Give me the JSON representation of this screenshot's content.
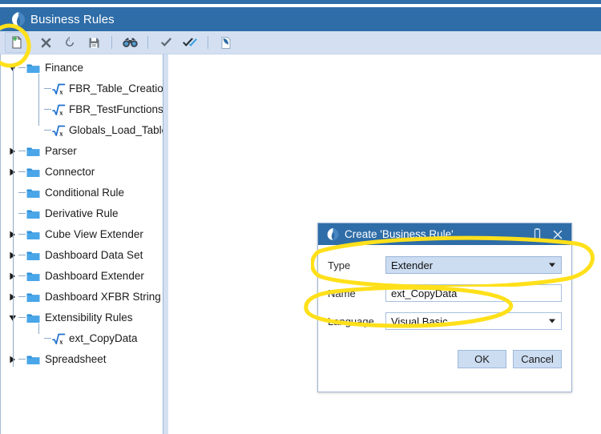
{
  "window": {
    "title": "Business Rules",
    "logo_icon": "onestream-logo-icon"
  },
  "toolbar": {
    "buttons": [
      {
        "name": "new-rule-button",
        "icon": "new-document-icon",
        "label": "New"
      },
      {
        "name": "delete-button",
        "icon": "delete-x-icon",
        "label": "Delete"
      },
      {
        "name": "refresh-button",
        "icon": "refresh-icon",
        "label": "Refresh"
      },
      {
        "name": "save-button",
        "icon": "save-disk-icon",
        "label": "Save"
      },
      {
        "name": "find-button",
        "icon": "binoculars-icon",
        "label": "Find"
      },
      {
        "name": "validate-button",
        "icon": "check-icon",
        "label": "Validate"
      },
      {
        "name": "validate-all-button",
        "icon": "double-check-icon",
        "label": "Validate and Compile"
      },
      {
        "name": "page-button",
        "icon": "page-curl-icon",
        "label": "Page"
      }
    ]
  },
  "tree": {
    "items": [
      {
        "label": "Finance",
        "level": 0,
        "icon": "folder-icon",
        "state": "expanded"
      },
      {
        "label": "FBR_Table_Creation",
        "level": 1,
        "icon": "formula-icon",
        "state": "leaf"
      },
      {
        "label": "FBR_TestFunctions",
        "level": 1,
        "icon": "formula-icon",
        "state": "leaf"
      },
      {
        "label": "Globals_Load_Table",
        "level": 1,
        "icon": "formula-icon",
        "state": "leaf"
      },
      {
        "label": "Parser",
        "level": 0,
        "icon": "folder-icon",
        "state": "collapsed"
      },
      {
        "label": "Connector",
        "level": 0,
        "icon": "folder-icon",
        "state": "collapsed"
      },
      {
        "label": "Conditional Rule",
        "level": 0,
        "icon": "folder-icon",
        "state": "empty"
      },
      {
        "label": "Derivative Rule",
        "level": 0,
        "icon": "folder-icon",
        "state": "empty"
      },
      {
        "label": "Cube View Extender",
        "level": 0,
        "icon": "folder-icon",
        "state": "collapsed"
      },
      {
        "label": "Dashboard Data Set",
        "level": 0,
        "icon": "folder-icon",
        "state": "collapsed"
      },
      {
        "label": "Dashboard Extender",
        "level": 0,
        "icon": "folder-icon",
        "state": "collapsed"
      },
      {
        "label": "Dashboard XFBR String",
        "level": 0,
        "icon": "folder-icon",
        "state": "collapsed"
      },
      {
        "label": "Extensibility Rules",
        "level": 0,
        "icon": "folder-icon",
        "state": "expanded"
      },
      {
        "label": "ext_CopyData",
        "level": 1,
        "icon": "formula-icon",
        "state": "leaf"
      },
      {
        "label": "Spreadsheet",
        "level": 0,
        "icon": "folder-icon",
        "state": "collapsed"
      }
    ]
  },
  "dialog": {
    "title": "Create 'Business Rule'",
    "logo_icon": "onestream-logo-icon",
    "pin_icon": "pin-icon",
    "close_icon": "close-icon",
    "fields": {
      "type": {
        "label": "Type",
        "value": "Extender"
      },
      "name": {
        "label": "Name",
        "value": "ext_CopyData",
        "placeholder": ""
      },
      "language": {
        "label": "Language",
        "value": "Visual Basic"
      }
    },
    "ok_label": "OK",
    "cancel_label": "Cancel"
  },
  "colors": {
    "titlebar": "#2e6da8",
    "toolbar": "#d4e0f2",
    "highlight": "#ffe01a",
    "combo_focus": "#ccdcf1"
  }
}
